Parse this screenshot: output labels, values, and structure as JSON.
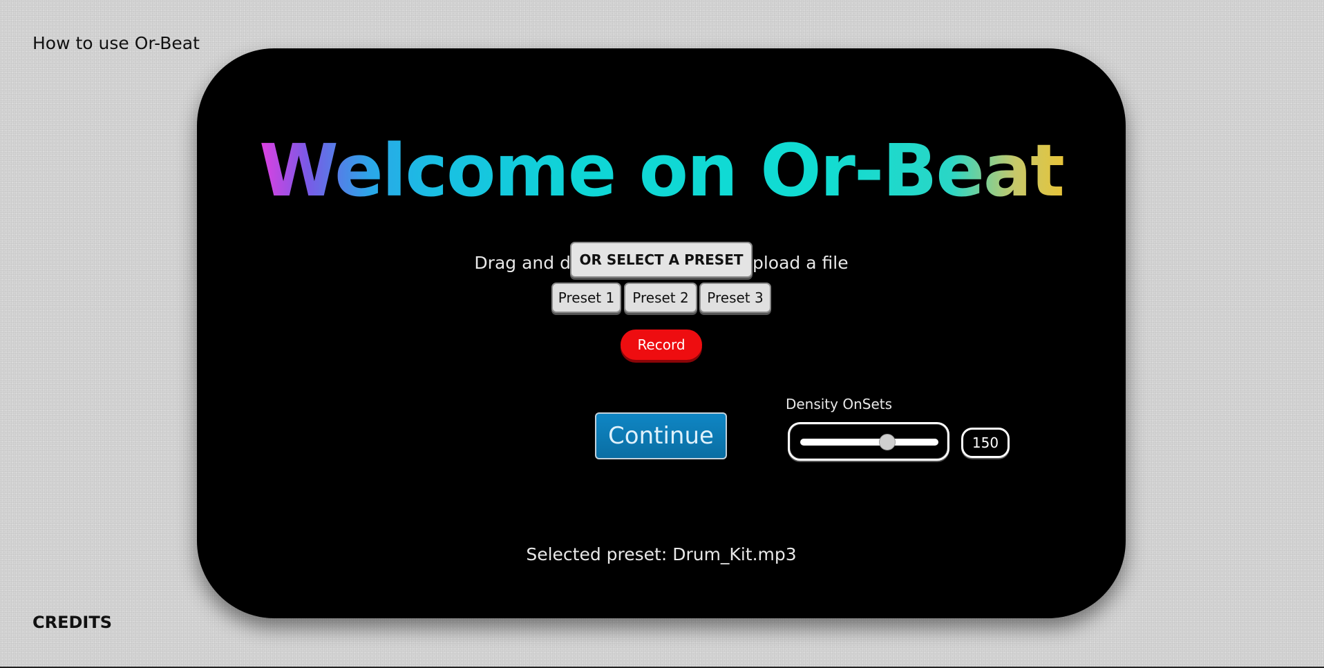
{
  "nav": {
    "how_to_label": "How to use Or-Beat",
    "credits_label": "CREDITS"
  },
  "main": {
    "title": "Welcome on Or-Beat",
    "upload_text": "Drag and drop or Click here to upload a file",
    "select_preset_label": "OR SELECT A PRESET",
    "presets": [
      {
        "label": "Preset 1"
      },
      {
        "label": "Preset 2"
      },
      {
        "label": "Preset 3"
      }
    ],
    "record_label": "Record",
    "continue_label": "Continue",
    "density": {
      "label": "Density OnSets",
      "value": "150",
      "fraction": 0.63
    },
    "selected_preset_text": "Selected preset: Drum_Kit.mp3"
  },
  "colors": {
    "page_background": "#d4d4d4",
    "card_background": "#000000",
    "record_red": "#ee0d10",
    "continue_blue": "#0f86c4",
    "title_gradient": [
      "#e040e0",
      "#2aa8e8",
      "#0fd6d6",
      "#e6c43a"
    ]
  }
}
